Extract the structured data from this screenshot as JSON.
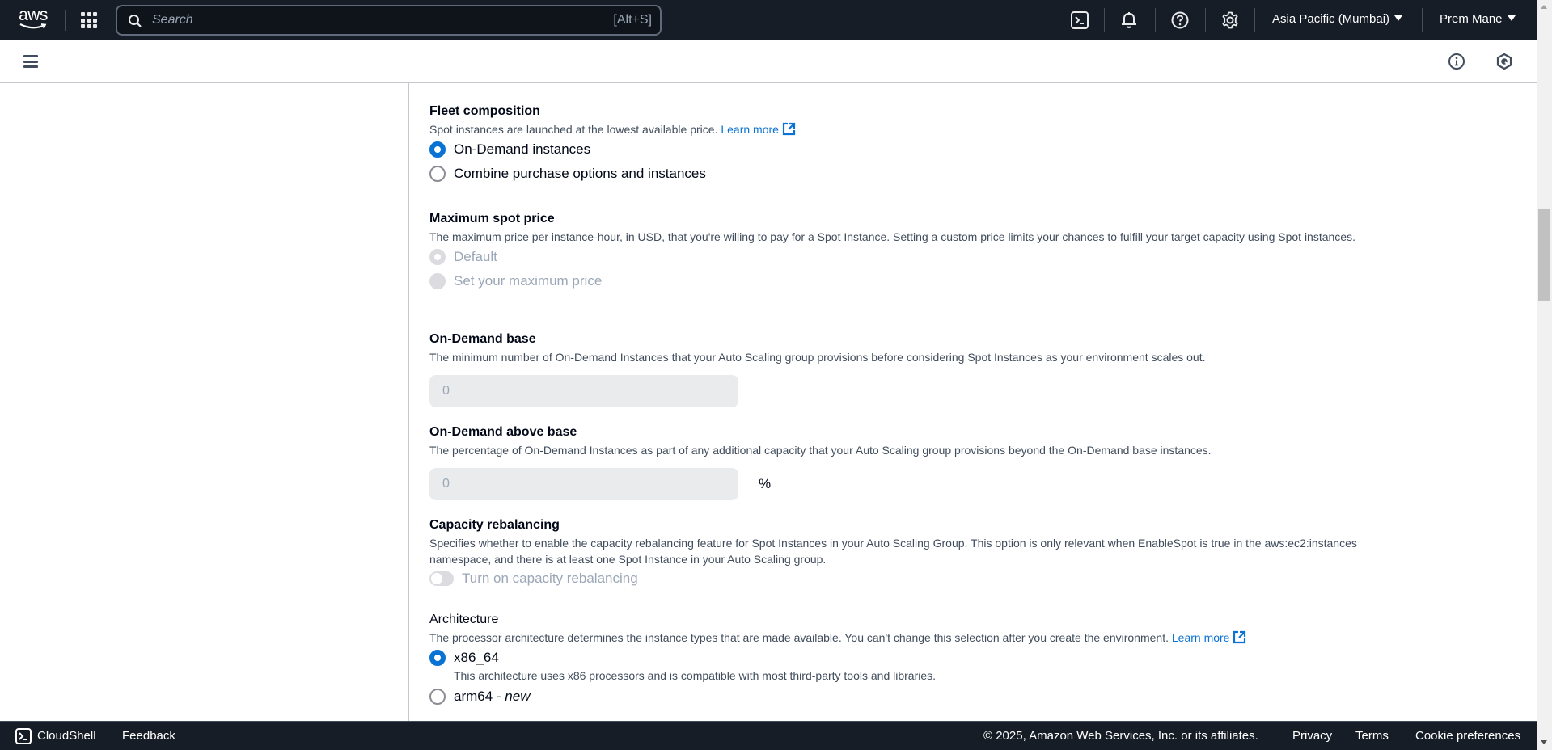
{
  "topbar": {
    "logo_text": "aws",
    "search_placeholder": "Search",
    "search_shortcut": "[Alt+S]",
    "icons": [
      "cloudshell-icon",
      "bell-icon",
      "help-icon",
      "gear-icon"
    ],
    "region": "Asia Pacific (Mumbai)",
    "user": "Prem Mane"
  },
  "subbar": {
    "icons": [
      "menu-icon",
      "info-icon",
      "hexagon-icon"
    ]
  },
  "form": {
    "fleet": {
      "title": "Fleet composition",
      "desc": "Spot instances are launched at the lowest available price.",
      "learn_more": "Learn more",
      "options": [
        {
          "label": "On-Demand instances",
          "checked": true
        },
        {
          "label": "Combine purchase options and instances",
          "checked": false
        }
      ]
    },
    "max_spot": {
      "title": "Maximum spot price",
      "desc": "The maximum price per instance-hour, in USD, that you're willing to pay for a Spot Instance. Setting a custom price limits your chances to fulfill your target capacity using Spot instances.",
      "options": [
        {
          "label": "Default",
          "checked": true,
          "disabled": true
        },
        {
          "label": "Set your maximum price",
          "checked": false,
          "disabled": true
        }
      ]
    },
    "od_base": {
      "title": "On-Demand base",
      "desc": "The minimum number of On-Demand Instances that your Auto Scaling group provisions before considering Spot Instances as your environment scales out.",
      "value": "0"
    },
    "od_above": {
      "title": "On-Demand above base",
      "desc": "The percentage of On-Demand Instances as part of any additional capacity that your Auto Scaling group provisions beyond the On-Demand base instances.",
      "value": "0",
      "unit": "%"
    },
    "rebalance": {
      "title": "Capacity rebalancing",
      "desc": "Specifies whether to enable the capacity rebalancing feature for Spot Instances in your Auto Scaling Group. This option is only relevant when EnableSpot is true in the aws:ec2:instances namespace, and there is at least one Spot Instance in your Auto Scaling group.",
      "toggle_label": "Turn on capacity rebalancing",
      "enabled": false
    },
    "arch": {
      "title": "Architecture",
      "desc": "The processor architecture determines the instance types that are made available. You can't change this selection after you create the environment.",
      "learn_more": "Learn more",
      "options": [
        {
          "label": "x86_64",
          "desc": "This architecture uses x86 processors and is compatible with most third-party tools and libraries.",
          "checked": true
        },
        {
          "label": "arm64 - ",
          "label_suffix": "new",
          "checked": false
        }
      ]
    }
  },
  "footer": {
    "cloudshell": "CloudShell",
    "feedback": "Feedback",
    "copyright": "© 2025, Amazon Web Services, Inc. or its affiliates.",
    "privacy": "Privacy",
    "terms": "Terms",
    "cookies": "Cookie preferences"
  },
  "colors": {
    "accent": "#0972d3",
    "topbar_bg": "#161d26"
  }
}
